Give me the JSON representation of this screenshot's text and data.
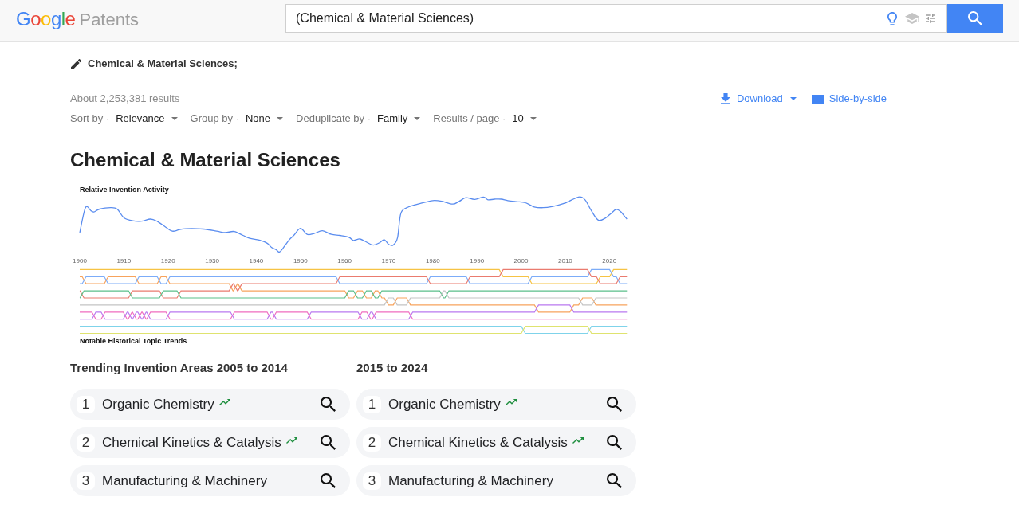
{
  "header": {
    "logo": "Google",
    "product": "Patents",
    "search": {
      "value": "(Chemical & Material Sciences)"
    }
  },
  "query": "Chemical & Material Sciences;",
  "results": {
    "count": "About 2,253,381 results",
    "actions": [
      {
        "kind": "download",
        "label": "Download"
      },
      {
        "kind": "side-by-side",
        "label": "Side-by-side"
      }
    ]
  },
  "options": [
    {
      "label": "Sort by ·",
      "value": "Relevance"
    },
    {
      "label": "Group by ·",
      "value": "None"
    },
    {
      "label": "Deduplicate by ·",
      "value": "Family"
    },
    {
      "label": "Results / page ·",
      "value": "10"
    }
  ],
  "title": "Chemical & Material Sciences",
  "activity_chart": {
    "title": "Relative Invention Activity",
    "year_labels": [
      "1900",
      "1910",
      "1920",
      "1930",
      "1940",
      "1950",
      "1960",
      "1970",
      "1980",
      "1990",
      "2000",
      "2010",
      "2020"
    ]
  },
  "topic_trends": {
    "title": "Notable Historical Topic Trends"
  },
  "trending": [
    {
      "heading": "Trending Invention Areas 2005 to 2014",
      "items": [
        {
          "rank": "1",
          "label": "Organic Chemistry",
          "rising": true
        },
        {
          "rank": "2",
          "label": "Chemical Kinetics & Catalysis",
          "rising": true
        },
        {
          "rank": "3",
          "label": "Manufacturing & Machinery",
          "rising": false
        }
      ]
    },
    {
      "heading": "2015 to 2024",
      "items": [
        {
          "rank": "1",
          "label": "Organic Chemistry",
          "rising": true
        },
        {
          "rank": "2",
          "label": "Chemical Kinetics & Catalysis",
          "rising": true
        },
        {
          "rank": "3",
          "label": "Manufacturing & Machinery",
          "rising": false
        }
      ]
    }
  ]
}
